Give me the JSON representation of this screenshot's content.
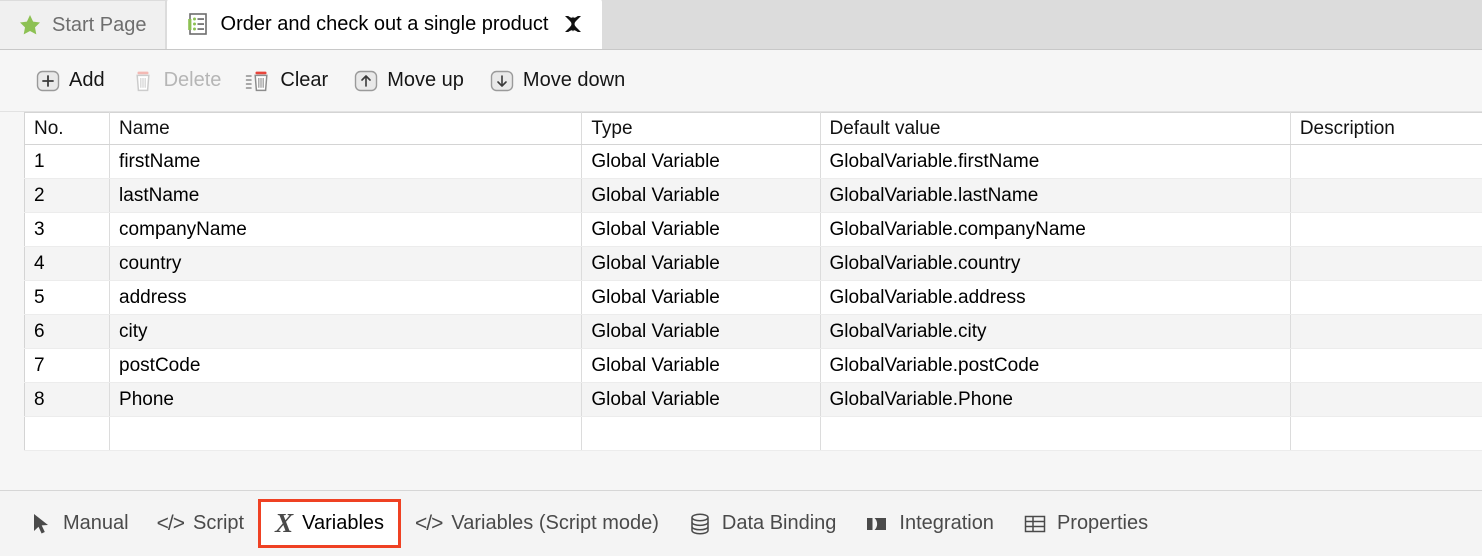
{
  "window": {
    "tabs": [
      {
        "label": "Start Page",
        "icon": "star-icon",
        "active": false,
        "closable": false
      },
      {
        "label": "Order and check out a single product",
        "icon": "test-case-icon",
        "active": true,
        "closable": true
      }
    ]
  },
  "toolbar": {
    "buttons": [
      {
        "label": "Add",
        "icon": "plus-box-icon",
        "enabled": true
      },
      {
        "label": "Delete",
        "icon": "trash-icon",
        "enabled": false
      },
      {
        "label": "Clear",
        "icon": "clear-all-icon",
        "enabled": true
      },
      {
        "label": "Move up",
        "icon": "arrow-up-box-icon",
        "enabled": true
      },
      {
        "label": "Move down",
        "icon": "arrow-down-box-icon",
        "enabled": true
      }
    ]
  },
  "table": {
    "columns": [
      "No.",
      "Name",
      "Type",
      "Default value",
      "Description"
    ],
    "rows": [
      {
        "no": "1",
        "name": "firstName",
        "type": "Global Variable",
        "default": "GlobalVariable.firstName",
        "description": ""
      },
      {
        "no": "2",
        "name": "lastName",
        "type": "Global Variable",
        "default": "GlobalVariable.lastName",
        "description": ""
      },
      {
        "no": "3",
        "name": "companyName",
        "type": "Global Variable",
        "default": "GlobalVariable.companyName",
        "description": ""
      },
      {
        "no": "4",
        "name": "country",
        "type": "Global Variable",
        "default": "GlobalVariable.country",
        "description": ""
      },
      {
        "no": "5",
        "name": "address",
        "type": "Global Variable",
        "default": "GlobalVariable.address",
        "description": ""
      },
      {
        "no": "6",
        "name": "city",
        "type": "Global Variable",
        "default": "GlobalVariable.city",
        "description": ""
      },
      {
        "no": "7",
        "name": "postCode",
        "type": "Global Variable",
        "default": "GlobalVariable.postCode",
        "description": ""
      },
      {
        "no": "8",
        "name": "Phone",
        "type": "Global Variable",
        "default": "GlobalVariable.Phone",
        "description": ""
      }
    ]
  },
  "bottom_tabs": [
    {
      "label": "Manual",
      "icon": "cursor-arrow-icon",
      "selected": false
    },
    {
      "label": "Script",
      "icon": "code-brackets-icon",
      "selected": false
    },
    {
      "label": "Variables",
      "icon": "variable-x-icon",
      "selected": true
    },
    {
      "label": "Variables (Script mode)",
      "icon": "code-brackets-icon",
      "selected": false
    },
    {
      "label": "Data Binding",
      "icon": "database-icon",
      "selected": false
    },
    {
      "label": "Integration",
      "icon": "integration-icon",
      "selected": false
    },
    {
      "label": "Properties",
      "icon": "table-grid-icon",
      "selected": false
    }
  ],
  "colors": {
    "highlight": "#EF4123",
    "star": "#8DC153",
    "tabstrip_bg": "#DCDCDC",
    "active_tab_bg": "#FFFFFF",
    "toolbar_bg": "#F6F6F6",
    "row_alt_bg": "#F4F4F4"
  }
}
